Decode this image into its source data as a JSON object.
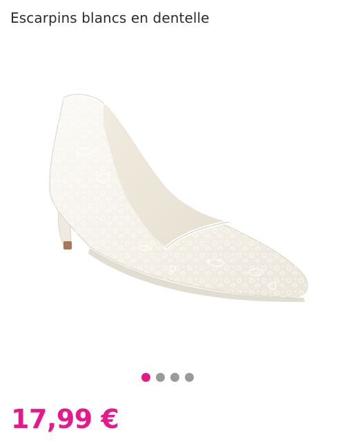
{
  "product": {
    "title": "Escarpins blancs en dentelle",
    "price": "17,99 €",
    "price_color": "#e6198a",
    "image_icon": "lace-pump-shoe-icon"
  },
  "carousel": {
    "count": 4,
    "active_index": 0,
    "active_color": "#e6198a",
    "inactive_color": "#9a9a9a"
  }
}
